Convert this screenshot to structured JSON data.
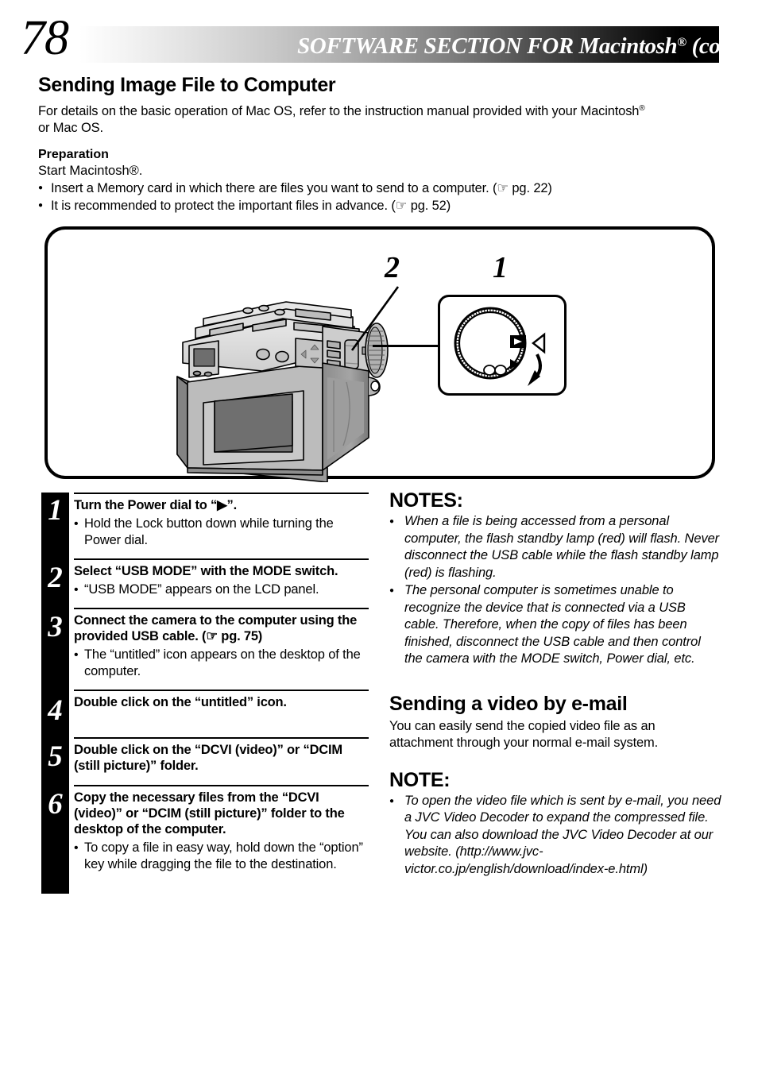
{
  "header": {
    "page_number": "78",
    "title_main": "SOFTWARE SECTION FOR Macintosh",
    "title_sup": "®",
    "title_tail": " (cont.)"
  },
  "intro": {
    "section_title": "Sending Image File to Computer",
    "paragraph_part1": "For details on the basic operation of Mac OS, refer to the instruction manual provided with your Macintosh",
    "paragraph_sup": "®",
    "paragraph_part2": "or Mac OS."
  },
  "preparation": {
    "heading": "Preparation",
    "line": "Start Macintosh®.",
    "bullets": [
      "Insert a Memory card in which there are files you want to send to a computer. (☞ pg. 22)",
      "It is recommended to protect the important files in advance. (☞ pg. 52)"
    ]
  },
  "diagram": {
    "callout_2": "2",
    "callout_1": "1",
    "camera_alt": "rear view of digital camera with LCD panel, D-pad, MODE switch and Power dial",
    "dial_alt": "close-up of Power dial showing play position and rotation arrow",
    "dial_play_symbol": "▶"
  },
  "steps": [
    {
      "number": "1",
      "title": "Turn the Power dial to “▶”.",
      "subs": [
        "Hold the Lock button down while turning the Power dial."
      ]
    },
    {
      "number": "2",
      "title": "Select “USB MODE” with the MODE switch.",
      "subs": [
        "“USB MODE” appears on the LCD panel."
      ]
    },
    {
      "number": "3",
      "title": "Connect the camera to the computer using the provided USB cable. (☞ pg. 75)",
      "subs": [
        "The “untitled” icon appears on the desktop of the computer."
      ]
    },
    {
      "number": "4",
      "title": "Double click on the “untitled” icon.",
      "subs": []
    },
    {
      "number": "5",
      "title": "Double click on the “DCVI (video)” or “DCIM (still picture)” folder.",
      "subs": []
    },
    {
      "number": "6",
      "title": "Copy the necessary files from the “DCVI (video)” or “DCIM (still picture)” folder to the desktop of the computer.",
      "subs": [
        "To copy a file in easy way, hold down the “option” key while dragging the file to the destination."
      ]
    }
  ],
  "notes": {
    "heading": "NOTES:",
    "items": [
      "When a file is being accessed from a personal computer, the flash standby lamp (red) will flash. Never disconnect the USB cable while the flash standby lamp (red) is flashing.",
      "The personal computer is sometimes unable to recognize the device that is connected via a USB cable. Therefore, when the copy of files has been finished, disconnect the USB cable and then control the camera with the MODE switch, Power dial, etc."
    ]
  },
  "email_section": {
    "title": "Sending a video by e-mail",
    "paragraph": "You can easily send the copied video file as an attachment through your normal e-mail system.",
    "note_heading": "NOTE:",
    "note_items": [
      "To open the video file which is sent by e-mail, you need a JVC Video Decoder to expand the compressed file. You can also download the JVC Video Decoder at our website. (http://www.jvc-victor.co.jp/english/download/index-e.html)"
    ]
  }
}
